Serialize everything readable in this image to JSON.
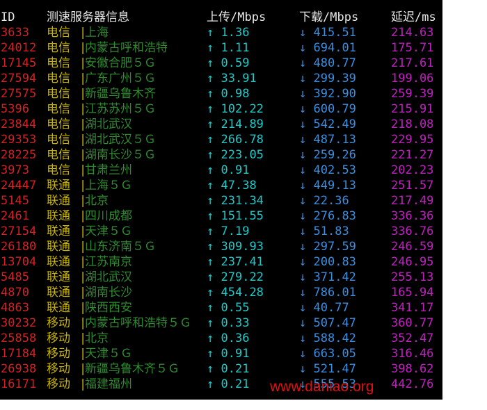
{
  "header": {
    "id": "ID",
    "server": "测速服务器信息",
    "upload": "上传/Mbps",
    "download": "下载/Mbps",
    "latency": "延迟/ms"
  },
  "separator": "|",
  "up_arrow": "↑",
  "down_arrow": "↓",
  "rows": [
    {
      "id": "3633",
      "isp": "电信",
      "city": "上海",
      "up": "1.36",
      "down": "415.51",
      "latency": "214.63"
    },
    {
      "id": "24012",
      "isp": "电信",
      "city": "内蒙古呼和浩特",
      "up": "1.11",
      "down": "694.01",
      "latency": "175.71"
    },
    {
      "id": "17145",
      "isp": "电信",
      "city": "安徽合肥５Ｇ",
      "up": "0.59",
      "down": "480.77",
      "latency": "217.61"
    },
    {
      "id": "27594",
      "isp": "电信",
      "city": "广东广州５Ｇ",
      "up": "33.91",
      "down": "299.39",
      "latency": "199.06"
    },
    {
      "id": "27575",
      "isp": "电信",
      "city": "新疆乌鲁木齐",
      "up": "0.98",
      "down": "392.90",
      "latency": "259.39"
    },
    {
      "id": "5396",
      "isp": "电信",
      "city": "江苏苏州５Ｇ",
      "up": "102.22",
      "down": "600.79",
      "latency": "215.91"
    },
    {
      "id": "23844",
      "isp": "电信",
      "city": "湖北武汉",
      "up": "214.89",
      "down": "542.49",
      "latency": "218.08"
    },
    {
      "id": "29353",
      "isp": "电信",
      "city": "湖北武汉５Ｇ",
      "up": "266.78",
      "down": "487.13",
      "latency": "229.95"
    },
    {
      "id": "28225",
      "isp": "电信",
      "city": "湖南长沙５Ｇ",
      "up": "223.05",
      "down": "259.26",
      "latency": "221.27"
    },
    {
      "id": "3973",
      "isp": "电信",
      "city": "甘肃兰州",
      "up": "0.91",
      "down": "402.53",
      "latency": "202.23"
    },
    {
      "id": "24447",
      "isp": "联通",
      "city": "上海５Ｇ",
      "up": "47.38",
      "down": "449.13",
      "latency": "251.57"
    },
    {
      "id": "5145",
      "isp": "联通",
      "city": "北京",
      "up": "231.34",
      "down": "22.36",
      "latency": "217.49"
    },
    {
      "id": "2461",
      "isp": "联通",
      "city": "四川成都",
      "up": "151.55",
      "down": "276.83",
      "latency": "336.36"
    },
    {
      "id": "27154",
      "isp": "联通",
      "city": "天津５Ｇ",
      "up": "7.19",
      "down": "51.83",
      "latency": "336.76"
    },
    {
      "id": "26180",
      "isp": "联通",
      "city": "山东济南５Ｇ",
      "up": "309.93",
      "down": "297.59",
      "latency": "246.59"
    },
    {
      "id": "13704",
      "isp": "联通",
      "city": "江苏南京",
      "up": "237.41",
      "down": "200.83",
      "latency": "246.95"
    },
    {
      "id": "5485",
      "isp": "联通",
      "city": "湖北武汉",
      "up": "279.22",
      "down": "371.42",
      "latency": "255.13"
    },
    {
      "id": "4870",
      "isp": "联通",
      "city": "湖南长沙",
      "up": "454.28",
      "down": "786.01",
      "latency": "165.94"
    },
    {
      "id": "4863",
      "isp": "联通",
      "city": "陕西西安",
      "up": "0.55",
      "down": "40.77",
      "latency": "341.17"
    },
    {
      "id": "30232",
      "isp": "移动",
      "city": "内蒙古呼和浩特５Ｇ",
      "up": "0.33",
      "down": "507.47",
      "latency": "360.77"
    },
    {
      "id": "25858",
      "isp": "移动",
      "city": "北京",
      "up": "0.36",
      "down": "588.42",
      "latency": "352.47"
    },
    {
      "id": "17184",
      "isp": "移动",
      "city": "天津５Ｇ",
      "up": "0.91",
      "down": "663.05",
      "latency": "316.46"
    },
    {
      "id": "26938",
      "isp": "移动",
      "city": "新疆乌鲁木齐５Ｇ",
      "up": "0.21",
      "down": "521.47",
      "latency": "398.62"
    },
    {
      "id": "16171",
      "isp": "移动",
      "city": "福建福州",
      "up": "0.21",
      "down": "555.53",
      "latency": "442.76"
    }
  ],
  "watermark": "www.daniao.org",
  "colors": {
    "background": "#000000",
    "id": "#d42020",
    "isp": "#c8b400",
    "city": "#2e8b2e",
    "upload": "#22c8c8",
    "download": "#3a8ee0",
    "latency": "#c020c0",
    "watermark": "#e01010"
  }
}
